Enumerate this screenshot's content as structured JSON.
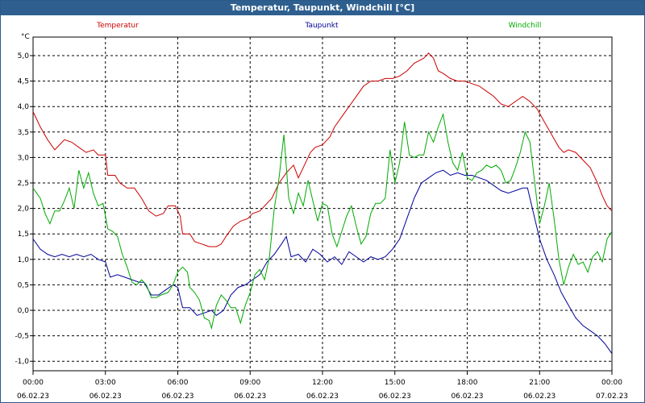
{
  "window": {
    "title": "Temperatur, Taupunkt, Windchill [°C]"
  },
  "chart_data": {
    "type": "line",
    "title": "Temperatur, Taupunkt, Windchill [°C]",
    "ylabel": "°C",
    "ylim": [
      -1.2,
      5.3
    ],
    "xlim": [
      0,
      24
    ],
    "grid": true,
    "legend_position": "top",
    "y_ticks": [
      {
        "v": 5.0,
        "label": "5,0"
      },
      {
        "v": 4.5,
        "label": "4,5"
      },
      {
        "v": 4.0,
        "label": "4,0"
      },
      {
        "v": 3.5,
        "label": "3,5"
      },
      {
        "v": 3.0,
        "label": "3,0"
      },
      {
        "v": 2.5,
        "label": "2,5"
      },
      {
        "v": 2.0,
        "label": "2,0"
      },
      {
        "v": 1.5,
        "label": "1,5"
      },
      {
        "v": 1.0,
        "label": "1,0"
      },
      {
        "v": 0.5,
        "label": "0,5"
      },
      {
        "v": 0.0,
        "label": "0,0"
      },
      {
        "v": -0.5,
        "label": "-0,5"
      },
      {
        "v": -1.0,
        "label": "-1,0"
      }
    ],
    "x_ticks": [
      {
        "h": 0,
        "time": "00:00",
        "date": "06.02.23"
      },
      {
        "h": 3,
        "time": "03:00",
        "date": "06.02.23"
      },
      {
        "h": 6,
        "time": "06:00",
        "date": "06.02.23"
      },
      {
        "h": 9,
        "time": "09:00",
        "date": "06.02.23"
      },
      {
        "h": 12,
        "time": "12:00",
        "date": "06.02.23"
      },
      {
        "h": 15,
        "time": "15:00",
        "date": "06.02.23"
      },
      {
        "h": 18,
        "time": "18:00",
        "date": "06.02.23"
      },
      {
        "h": 21,
        "time": "21:00",
        "date": "06.02.23"
      },
      {
        "h": 24,
        "time": "00:00",
        "date": "07.02.23"
      }
    ],
    "series": [
      {
        "name": "Temperatur",
        "color": "#cc0000",
        "points": [
          [
            0,
            3.9
          ],
          [
            0.3,
            3.6
          ],
          [
            0.6,
            3.35
          ],
          [
            0.9,
            3.15
          ],
          [
            1.1,
            3.25
          ],
          [
            1.3,
            3.35
          ],
          [
            1.6,
            3.3
          ],
          [
            1.9,
            3.2
          ],
          [
            2.2,
            3.1
          ],
          [
            2.5,
            3.15
          ],
          [
            2.7,
            3.05
          ],
          [
            3.0,
            3.05
          ],
          [
            3.1,
            2.65
          ],
          [
            3.4,
            2.65
          ],
          [
            3.6,
            2.5
          ],
          [
            3.9,
            2.4
          ],
          [
            4.2,
            2.4
          ],
          [
            4.5,
            2.2
          ],
          [
            4.8,
            1.95
          ],
          [
            5.1,
            1.85
          ],
          [
            5.4,
            1.9
          ],
          [
            5.6,
            2.05
          ],
          [
            5.9,
            2.05
          ],
          [
            6.1,
            1.85
          ],
          [
            6.2,
            1.5
          ],
          [
            6.5,
            1.5
          ],
          [
            6.7,
            1.35
          ],
          [
            7.0,
            1.3
          ],
          [
            7.3,
            1.25
          ],
          [
            7.6,
            1.25
          ],
          [
            7.8,
            1.3
          ],
          [
            8.0,
            1.45
          ],
          [
            8.3,
            1.65
          ],
          [
            8.6,
            1.75
          ],
          [
            8.9,
            1.8
          ],
          [
            9.1,
            1.9
          ],
          [
            9.4,
            1.95
          ],
          [
            9.7,
            2.1
          ],
          [
            9.9,
            2.2
          ],
          [
            10.2,
            2.5
          ],
          [
            10.5,
            2.7
          ],
          [
            10.8,
            2.85
          ],
          [
            11.0,
            2.6
          ],
          [
            11.3,
            2.9
          ],
          [
            11.5,
            3.1
          ],
          [
            11.7,
            3.2
          ],
          [
            12.0,
            3.25
          ],
          [
            12.3,
            3.4
          ],
          [
            12.5,
            3.6
          ],
          [
            12.8,
            3.8
          ],
          [
            13.1,
            4.0
          ],
          [
            13.4,
            4.2
          ],
          [
            13.7,
            4.4
          ],
          [
            14.0,
            4.5
          ],
          [
            14.3,
            4.5
          ],
          [
            14.6,
            4.55
          ],
          [
            14.9,
            4.55
          ],
          [
            15.2,
            4.6
          ],
          [
            15.5,
            4.7
          ],
          [
            15.8,
            4.85
          ],
          [
            16.0,
            4.9
          ],
          [
            16.2,
            4.95
          ],
          [
            16.4,
            5.05
          ],
          [
            16.6,
            4.95
          ],
          [
            16.8,
            4.7
          ],
          [
            17.0,
            4.65
          ],
          [
            17.3,
            4.55
          ],
          [
            17.6,
            4.5
          ],
          [
            17.9,
            4.5
          ],
          [
            18.2,
            4.45
          ],
          [
            18.5,
            4.4
          ],
          [
            18.8,
            4.3
          ],
          [
            19.1,
            4.2
          ],
          [
            19.4,
            4.05
          ],
          [
            19.7,
            4.0
          ],
          [
            20.0,
            4.1
          ],
          [
            20.3,
            4.2
          ],
          [
            20.6,
            4.1
          ],
          [
            20.9,
            3.95
          ],
          [
            21.2,
            3.7
          ],
          [
            21.5,
            3.45
          ],
          [
            21.8,
            3.2
          ],
          [
            22.0,
            3.1
          ],
          [
            22.2,
            3.15
          ],
          [
            22.5,
            3.1
          ],
          [
            22.8,
            2.95
          ],
          [
            23.1,
            2.8
          ],
          [
            23.4,
            2.5
          ],
          [
            23.6,
            2.25
          ],
          [
            23.8,
            2.05
          ],
          [
            24.0,
            1.95
          ]
        ]
      },
      {
        "name": "Taupunkt",
        "color": "#000099",
        "points": [
          [
            0,
            1.4
          ],
          [
            0.3,
            1.2
          ],
          [
            0.6,
            1.1
          ],
          [
            0.9,
            1.05
          ],
          [
            1.2,
            1.1
          ],
          [
            1.5,
            1.05
          ],
          [
            1.8,
            1.1
          ],
          [
            2.1,
            1.05
          ],
          [
            2.4,
            1.1
          ],
          [
            2.7,
            1.0
          ],
          [
            3.0,
            0.95
          ],
          [
            3.2,
            0.65
          ],
          [
            3.5,
            0.7
          ],
          [
            3.8,
            0.65
          ],
          [
            4.1,
            0.6
          ],
          [
            4.4,
            0.55
          ],
          [
            4.6,
            0.55
          ],
          [
            4.9,
            0.3
          ],
          [
            5.2,
            0.3
          ],
          [
            5.5,
            0.4
          ],
          [
            5.8,
            0.5
          ],
          [
            6.0,
            0.45
          ],
          [
            6.2,
            0.05
          ],
          [
            6.5,
            0.05
          ],
          [
            6.8,
            -0.1
          ],
          [
            7.1,
            -0.05
          ],
          [
            7.4,
            0.0
          ],
          [
            7.6,
            -0.1
          ],
          [
            7.9,
            0.0
          ],
          [
            8.2,
            0.3
          ],
          [
            8.5,
            0.45
          ],
          [
            8.8,
            0.5
          ],
          [
            9.1,
            0.6
          ],
          [
            9.4,
            0.7
          ],
          [
            9.7,
            0.95
          ],
          [
            10.0,
            1.1
          ],
          [
            10.3,
            1.3
          ],
          [
            10.5,
            1.45
          ],
          [
            10.7,
            1.05
          ],
          [
            11.0,
            1.1
          ],
          [
            11.3,
            0.95
          ],
          [
            11.6,
            1.2
          ],
          [
            11.9,
            1.1
          ],
          [
            12.2,
            0.95
          ],
          [
            12.5,
            1.05
          ],
          [
            12.8,
            0.9
          ],
          [
            13.1,
            1.15
          ],
          [
            13.4,
            1.05
          ],
          [
            13.7,
            0.95
          ],
          [
            14.0,
            1.05
          ],
          [
            14.3,
            1.0
          ],
          [
            14.6,
            1.05
          ],
          [
            14.9,
            1.2
          ],
          [
            15.2,
            1.4
          ],
          [
            15.5,
            1.8
          ],
          [
            15.8,
            2.2
          ],
          [
            16.1,
            2.5
          ],
          [
            16.4,
            2.6
          ],
          [
            16.7,
            2.7
          ],
          [
            17.0,
            2.75
          ],
          [
            17.3,
            2.65
          ],
          [
            17.6,
            2.7
          ],
          [
            17.9,
            2.65
          ],
          [
            18.2,
            2.65
          ],
          [
            18.5,
            2.6
          ],
          [
            18.8,
            2.55
          ],
          [
            19.1,
            2.45
          ],
          [
            19.4,
            2.35
          ],
          [
            19.7,
            2.3
          ],
          [
            20.0,
            2.35
          ],
          [
            20.3,
            2.4
          ],
          [
            20.5,
            2.4
          ],
          [
            20.7,
            2.0
          ],
          [
            21.0,
            1.4
          ],
          [
            21.3,
            1.0
          ],
          [
            21.6,
            0.7
          ],
          [
            21.9,
            0.35
          ],
          [
            22.2,
            0.1
          ],
          [
            22.5,
            -0.15
          ],
          [
            22.8,
            -0.3
          ],
          [
            23.1,
            -0.4
          ],
          [
            23.4,
            -0.5
          ],
          [
            23.7,
            -0.65
          ],
          [
            24.0,
            -0.85
          ]
        ]
      },
      {
        "name": "Windchill",
        "color": "#00aa00",
        "points": [
          [
            0,
            2.4
          ],
          [
            0.3,
            2.2
          ],
          [
            0.5,
            1.9
          ],
          [
            0.7,
            1.7
          ],
          [
            0.9,
            1.95
          ],
          [
            1.1,
            1.95
          ],
          [
            1.3,
            2.15
          ],
          [
            1.5,
            2.4
          ],
          [
            1.7,
            2.0
          ],
          [
            1.9,
            2.75
          ],
          [
            2.1,
            2.4
          ],
          [
            2.3,
            2.7
          ],
          [
            2.5,
            2.3
          ],
          [
            2.7,
            2.05
          ],
          [
            2.9,
            2.1
          ],
          [
            3.0,
            1.85
          ],
          [
            3.1,
            1.6
          ],
          [
            3.3,
            1.55
          ],
          [
            3.5,
            1.45
          ],
          [
            3.7,
            1.1
          ],
          [
            3.9,
            0.85
          ],
          [
            4.1,
            0.55
          ],
          [
            4.3,
            0.5
          ],
          [
            4.5,
            0.6
          ],
          [
            4.7,
            0.5
          ],
          [
            4.9,
            0.25
          ],
          [
            5.1,
            0.25
          ],
          [
            5.3,
            0.3
          ],
          [
            5.6,
            0.35
          ],
          [
            5.8,
            0.5
          ],
          [
            6.0,
            0.75
          ],
          [
            6.2,
            0.85
          ],
          [
            6.4,
            0.75
          ],
          [
            6.5,
            0.45
          ],
          [
            6.7,
            0.35
          ],
          [
            6.9,
            0.2
          ],
          [
            7.1,
            -0.15
          ],
          [
            7.3,
            -0.2
          ],
          [
            7.4,
            -0.35
          ],
          [
            7.6,
            0.1
          ],
          [
            7.8,
            0.3
          ],
          [
            8.0,
            0.2
          ],
          [
            8.2,
            0.05
          ],
          [
            8.4,
            0.05
          ],
          [
            8.6,
            -0.25
          ],
          [
            8.8,
            0.1
          ],
          [
            9.0,
            0.35
          ],
          [
            9.2,
            0.7
          ],
          [
            9.4,
            0.8
          ],
          [
            9.6,
            0.6
          ],
          [
            9.8,
            1.05
          ],
          [
            10.0,
            2.0
          ],
          [
            10.2,
            2.6
          ],
          [
            10.4,
            3.45
          ],
          [
            10.6,
            2.2
          ],
          [
            10.8,
            1.9
          ],
          [
            11.0,
            2.3
          ],
          [
            11.2,
            2.05
          ],
          [
            11.4,
            2.55
          ],
          [
            11.6,
            2.15
          ],
          [
            11.8,
            1.75
          ],
          [
            12.0,
            2.1
          ],
          [
            12.2,
            2.05
          ],
          [
            12.4,
            1.5
          ],
          [
            12.6,
            1.25
          ],
          [
            12.8,
            1.55
          ],
          [
            13.0,
            1.85
          ],
          [
            13.2,
            2.05
          ],
          [
            13.4,
            1.65
          ],
          [
            13.6,
            1.3
          ],
          [
            13.8,
            1.45
          ],
          [
            14.0,
            1.9
          ],
          [
            14.2,
            2.1
          ],
          [
            14.4,
            2.1
          ],
          [
            14.6,
            2.2
          ],
          [
            14.8,
            3.15
          ],
          [
            15.0,
            2.5
          ],
          [
            15.2,
            2.9
          ],
          [
            15.4,
            3.7
          ],
          [
            15.6,
            3.05
          ],
          [
            15.8,
            3.0
          ],
          [
            16.0,
            3.05
          ],
          [
            16.2,
            3.05
          ],
          [
            16.4,
            3.5
          ],
          [
            16.6,
            3.3
          ],
          [
            16.8,
            3.6
          ],
          [
            17.0,
            3.85
          ],
          [
            17.2,
            3.3
          ],
          [
            17.4,
            2.9
          ],
          [
            17.6,
            2.75
          ],
          [
            17.8,
            3.1
          ],
          [
            18.0,
            2.6
          ],
          [
            18.2,
            2.55
          ],
          [
            18.4,
            2.7
          ],
          [
            18.6,
            2.75
          ],
          [
            18.8,
            2.85
          ],
          [
            19.0,
            2.8
          ],
          [
            19.2,
            2.85
          ],
          [
            19.4,
            2.75
          ],
          [
            19.6,
            2.5
          ],
          [
            19.8,
            2.55
          ],
          [
            20.0,
            2.8
          ],
          [
            20.2,
            3.1
          ],
          [
            20.4,
            3.5
          ],
          [
            20.6,
            3.3
          ],
          [
            20.8,
            2.5
          ],
          [
            21.0,
            1.7
          ],
          [
            21.2,
            2.05
          ],
          [
            21.4,
            2.5
          ],
          [
            21.6,
            1.8
          ],
          [
            21.8,
            1.0
          ],
          [
            22.0,
            0.5
          ],
          [
            22.2,
            0.85
          ],
          [
            22.4,
            1.1
          ],
          [
            22.6,
            0.9
          ],
          [
            22.8,
            0.95
          ],
          [
            23.0,
            0.75
          ],
          [
            23.2,
            1.05
          ],
          [
            23.4,
            1.15
          ],
          [
            23.6,
            0.95
          ],
          [
            23.8,
            1.4
          ],
          [
            24.0,
            1.55
          ]
        ]
      }
    ]
  }
}
